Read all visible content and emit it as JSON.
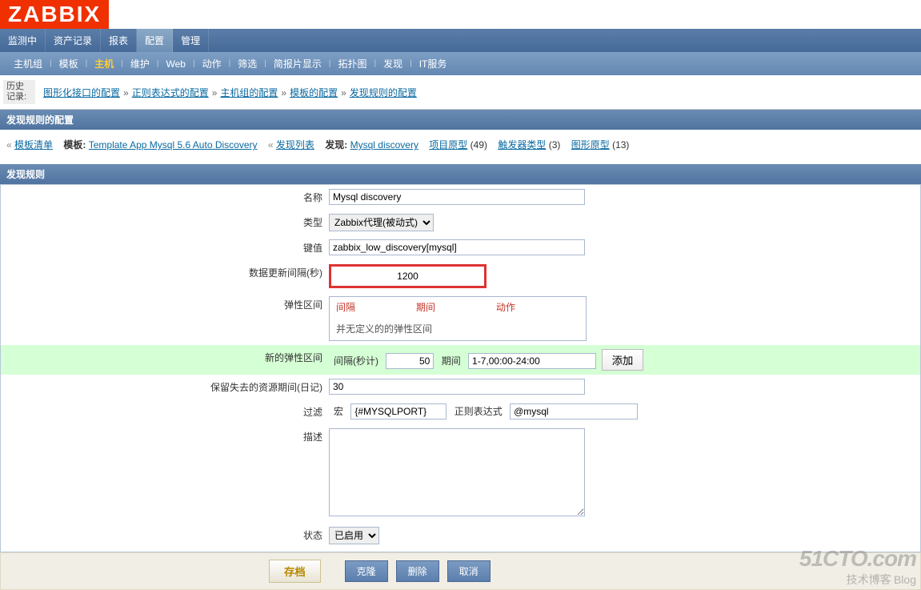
{
  "logo": "ZABBIX",
  "mainTabs": [
    "监测中",
    "资产记录",
    "报表",
    "配置",
    "管理"
  ],
  "mainActiveIdx": 3,
  "subTabs": [
    "主机组",
    "模板",
    "主机",
    "维护",
    "Web",
    "动作",
    "筛选",
    "简报片显示",
    "拓扑图",
    "发现",
    "IT服务"
  ],
  "subActiveIdx": 2,
  "history": {
    "label": "历史记录:",
    "items": [
      "图形化接口的配置",
      "正则表达式的配置",
      "主机组的配置",
      "模板的配置",
      "发现规则的配置"
    ]
  },
  "pageTitle": "发现规则的配置",
  "crumb": {
    "tplListPrefix": "«",
    "tplList": "模板清单",
    "tplLabel": "模板:",
    "tplLink": "Template App Mysql 5.6 Auto Discovery",
    "discListPrefix": "«",
    "discList": "发现列表",
    "discLabel": "发现:",
    "discLink": "Mysql discovery",
    "itemProto": "项目原型",
    "itemProtoCount": "(49)",
    "trigProto": "触发器类型",
    "trigProtoCount": "(3)",
    "graphProto": "图形原型",
    "graphProtoCount": "(13)"
  },
  "sectionTitle": "发现规则",
  "form": {
    "nameLabel": "名称",
    "nameValue": "Mysql discovery",
    "typeLabel": "类型",
    "typeValue": "Zabbix代理(被动式)",
    "keyLabel": "键值",
    "keyValue": "zabbix_low_discovery[mysql]",
    "intervalLabel": "数据更新间隔(秒)",
    "intervalValue": "1200",
    "flexLabel": "弹性区间",
    "flexCol1": "间隔",
    "flexCol2": "期间",
    "flexCol3": "动作",
    "flexEmpty": "并无定义的的弹性区间",
    "newFlexLabel": "新的弹性区间",
    "newFlexIntervalLabel": "间隔(秒计)",
    "newFlexIntervalValue": "50",
    "newFlexPeriodLabel": "期间",
    "newFlexPeriodValue": "1-7,00:00-24:00",
    "newFlexAdd": "添加",
    "keepLabel": "保留失去的资源期间(日记)",
    "keepValue": "30",
    "filterLabel": "过滤",
    "macroLabel": "宏",
    "macroValue": "{#MYSQLPORT}",
    "regexLabel": "正则表达式",
    "regexValue": "@mysql",
    "descLabel": "描述",
    "descValue": "",
    "statusLabel": "状态",
    "statusValue": "已启用"
  },
  "buttons": {
    "save": "存档",
    "clone": "克隆",
    "delete": "删除",
    "cancel": "取消"
  },
  "watermark": {
    "big": "51CTO.com",
    "small": "技术博客",
    "tag": "Blog"
  }
}
